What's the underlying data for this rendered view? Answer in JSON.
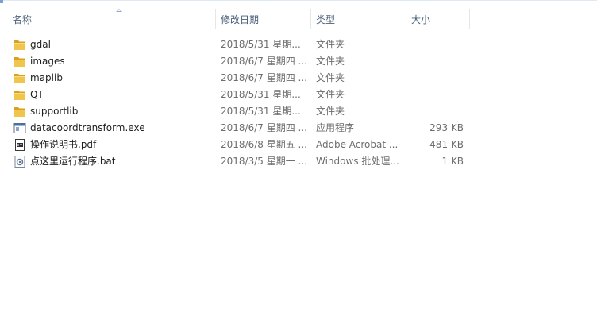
{
  "header": {
    "name": "名称",
    "date_modified": "修改日期",
    "type": "类型",
    "size": "大小"
  },
  "files": [
    {
      "name": "gdal",
      "date": "2018/5/31 星期...",
      "type": "文件夹",
      "size": "",
      "icon": "folder-icon"
    },
    {
      "name": "images",
      "date": "2018/6/7 星期四 ...",
      "type": "文件夹",
      "size": "",
      "icon": "folder-icon"
    },
    {
      "name": "maplib",
      "date": "2018/6/7 星期四 ...",
      "type": "文件夹",
      "size": "",
      "icon": "folder-icon"
    },
    {
      "name": "QT",
      "date": "2018/5/31 星期...",
      "type": "文件夹",
      "size": "",
      "icon": "folder-icon"
    },
    {
      "name": "supportlib",
      "date": "2018/5/31 星期...",
      "type": "文件夹",
      "size": "",
      "icon": "folder-icon"
    },
    {
      "name": "datacoordtransform.exe",
      "date": "2018/6/7 星期四 ...",
      "type": "应用程序",
      "size": "293 KB",
      "icon": "exe-icon"
    },
    {
      "name": "操作说明书.pdf",
      "date": "2018/6/8 星期五 ...",
      "type": "Adobe Acrobat ...",
      "size": "481 KB",
      "icon": "pdf-icon"
    },
    {
      "name": "点这里运行程序.bat",
      "date": "2018/3/5 星期一 ...",
      "type": "Windows 批处理...",
      "size": "1 KB",
      "icon": "bat-icon"
    }
  ],
  "colors": {
    "folder": "#e8b83a",
    "header_text": "#4c607a",
    "secondary_text": "#6d6d6d"
  }
}
